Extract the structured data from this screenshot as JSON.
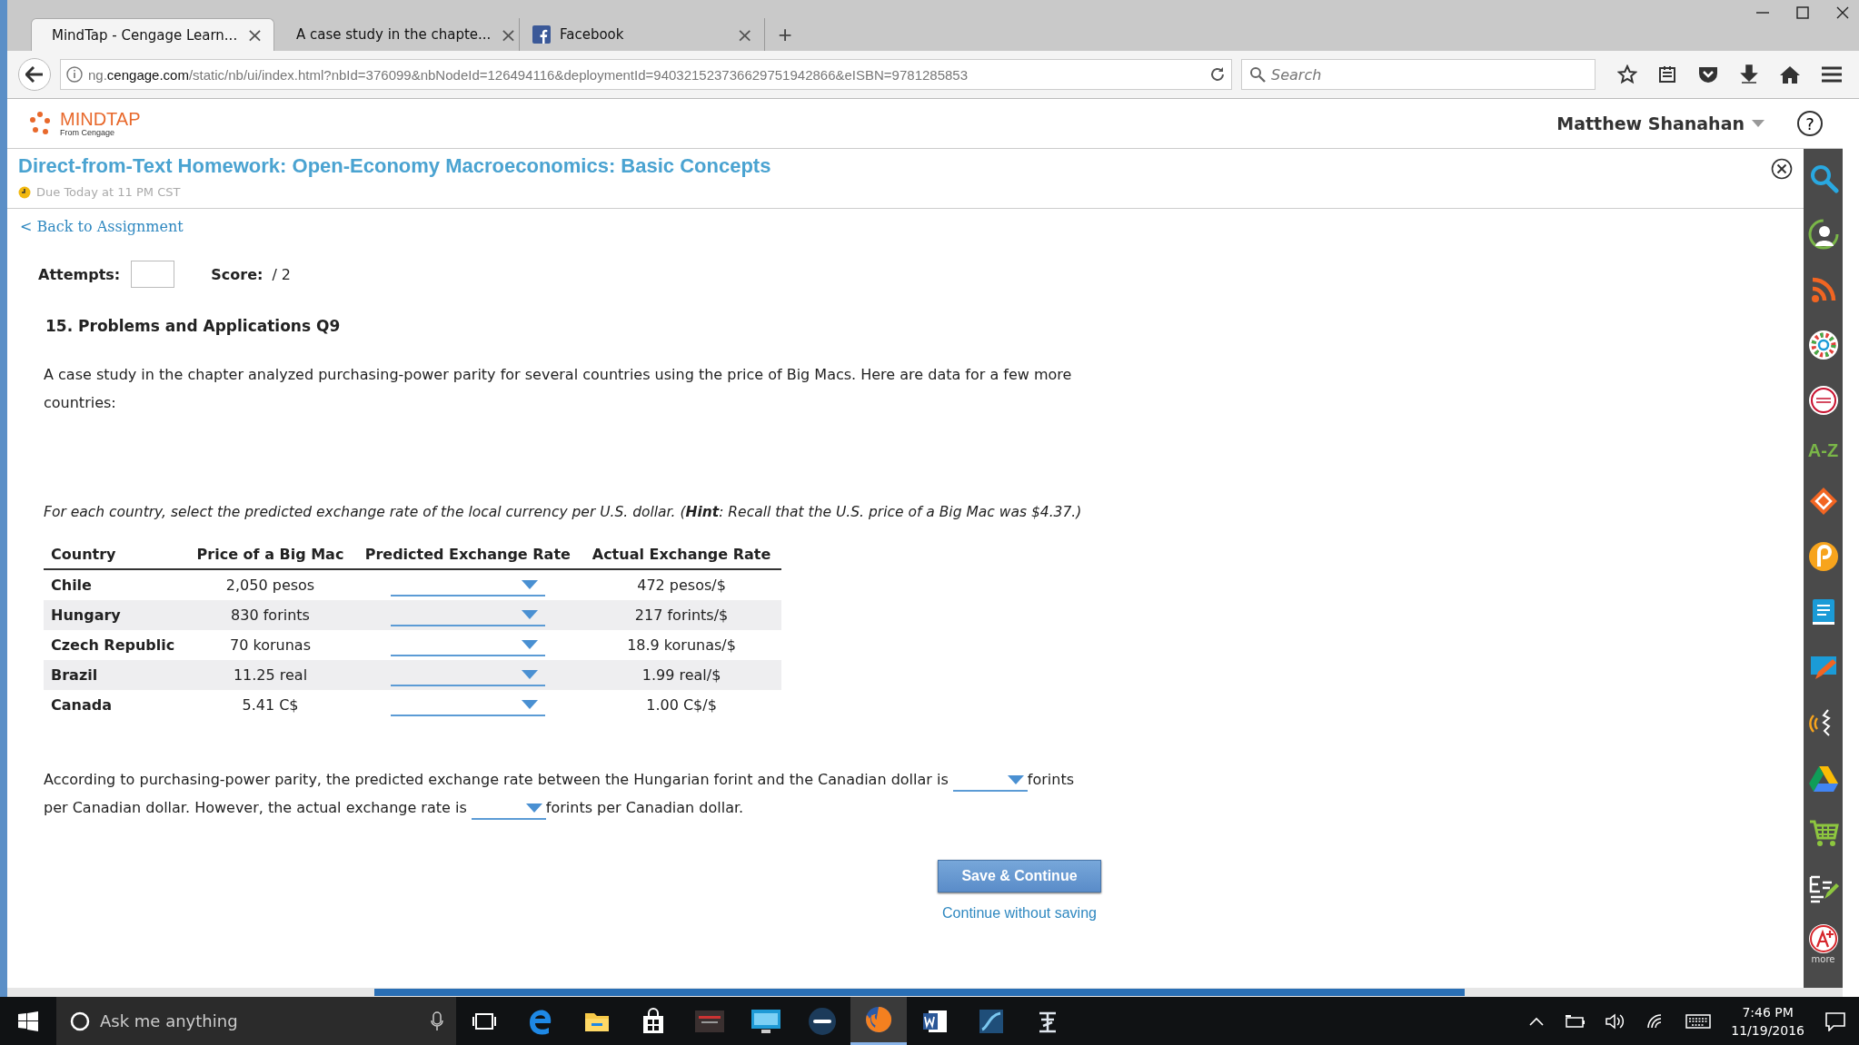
{
  "browser": {
    "tabs": [
      {
        "title": "MindTap - Cengage Learn...",
        "close": "×",
        "selected": true
      },
      {
        "title": "A case study in the chapte...",
        "close": "×",
        "selected": false
      },
      {
        "title": "Facebook",
        "close": "×",
        "selected": false
      }
    ],
    "new_tab": "+",
    "url": {
      "sub": "ng.",
      "host": "cengage.com",
      "path": "/static/nb/ui/index.html?nbId=376099&nbNodeId=126494116&deploymentId=940321523736629751942866&eISBN=9781285853"
    },
    "search_placeholder": "Search"
  },
  "app_header": {
    "logo": "MINDTAP",
    "logo_sub": "From Cengage",
    "user": "Matthew Shanahan",
    "help": "?"
  },
  "assignment": {
    "title": "Direct-from-Text Homework: Open-Economy Macroeconomics: Basic Concepts",
    "due": "Due Today at 11 PM CST"
  },
  "back_link": "< Back to Assignment",
  "attempts_label": "Attempts:",
  "score_label": "Score:",
  "score_value": "/ 2",
  "question": {
    "heading": "15. Problems and Applications Q9",
    "intro": "A case study in the chapter analyzed purchasing-power parity for several countries using the price of Big Macs. Here are data for a few more countries:",
    "instruction": "For each country, select the predicted exchange rate of the local currency per U.S. dollar. (**Hint**: Recall that the U.S. price of a Big Mac was $4.37.)"
  },
  "table": {
    "columns": [
      "Country",
      "Price of a Big Mac",
      "Predicted Exchange Rate",
      "Actual Exchange Rate"
    ],
    "rows": [
      {
        "country": "Chile",
        "price": "2,050 pesos",
        "actual": "472 pesos/$"
      },
      {
        "country": "Hungary",
        "price": "830 forints",
        "actual": "217 forints/$"
      },
      {
        "country": "Czech Republic",
        "price": "70 korunas",
        "actual": "18.9 korunas/$"
      },
      {
        "country": "Brazil",
        "price": "11.25 real",
        "actual": "1.99 real/$"
      },
      {
        "country": "Canada",
        "price": "5.41 C$",
        "actual": "1.00 C$/$"
      }
    ]
  },
  "conclusion": [
    "According to purchasing-power parity, the predicted exchange rate between the Hungarian forint and the Canadian dollar is",
    "forints",
    "per Canadian dollar. However, the actual exchange rate is",
    "forints per Canadian dollar."
  ],
  "buttons": {
    "save": "Save & Continue",
    "skip": "Continue without saving"
  },
  "sidebar": {
    "az_label": "A-Z",
    "more_label": "more"
  },
  "taskbar": {
    "search_placeholder": "Ask me anything",
    "time": "7:46 PM",
    "date": "11/19/2016"
  }
}
